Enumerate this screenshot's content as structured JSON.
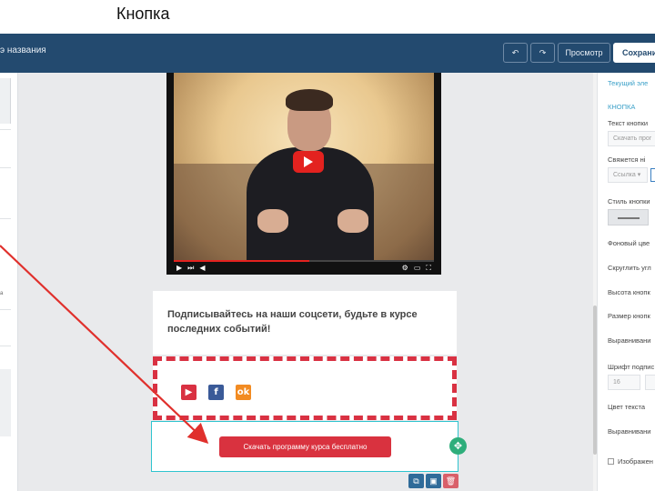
{
  "slide": {
    "title": "Кнопка"
  },
  "topbar": {
    "doc_title": "э названия",
    "undo_icon": "↶",
    "redo_icon": "↷",
    "preview_label": "Просмотр",
    "save_label": "Сохрани"
  },
  "left_panel": {
    "tick": "a"
  },
  "video": {
    "progress": 0.52,
    "controls": {
      "play": "▶",
      "next": "⏭",
      "volume": "◀",
      "hd": "⚙",
      "cc": "▭",
      "fullscreen": "⛶"
    }
  },
  "text_block": {
    "text": "Подписывайтесь на наши соцсети, будьте в курсе последних событий!"
  },
  "social": {
    "youtube_glyph": "▶",
    "facebook_glyph": "f",
    "ok_glyph": "ok"
  },
  "button_block": {
    "label": "Скачать программу курса бесплатно",
    "handle_glyph": "✥"
  },
  "tools": {
    "copy": "⧉",
    "save": "▣",
    "delete": "🗑"
  },
  "right_panel": {
    "current": "Текущий эле",
    "section": "КНОПКА",
    "button_text_label": "Текст кнопки",
    "button_text_value": "Скачать прог",
    "link_label": "Свяжется ні",
    "link_value": "Ссылка ▾",
    "style_label": "Стиль кнопки",
    "bg_label": "Фоновый цве",
    "round_label": "Скруглить угл",
    "height_label": "Высота кнопк",
    "size_label": "Размер кнопк",
    "align_label": "Выравнивани",
    "font_label": "Шрифт подпис",
    "font_size_value": "16",
    "text_color_label": "Цвет текста",
    "align2_label": "Выравнивани",
    "image_label": "Изображен"
  },
  "colors": {
    "topbar": "#234a6f",
    "accent": "#d9323f",
    "selection": "#2fc4cf"
  }
}
